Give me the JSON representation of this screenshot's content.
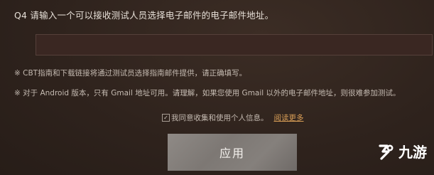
{
  "question": {
    "title": "Q4 请输入一个可以接收测试人员选择电子邮件的电子邮件地址。"
  },
  "email": {
    "value": "",
    "placeholder": ""
  },
  "notes": [
    "※ CBT指南和下载链接将通过测试员选择指南邮件提供，请正确填写。",
    "※ 对于 Android 版本，只有 Gmail 地址可用。请理解，如果您使用 Gmail 以外的电子邮件地址，则很难参加测试。"
  ],
  "consent": {
    "checked": true,
    "check_glyph": "✓",
    "label": "我同意收集和使用个人信息。",
    "link": "阅读更多"
  },
  "apply_button": {
    "label": "应用"
  },
  "watermark": {
    "text": "九游",
    "icon": "jiuyou-logo-icon"
  },
  "colors": {
    "background": "#2f231d",
    "input_background": "#3a2722",
    "link": "#d79d56",
    "button": "#85807c"
  }
}
